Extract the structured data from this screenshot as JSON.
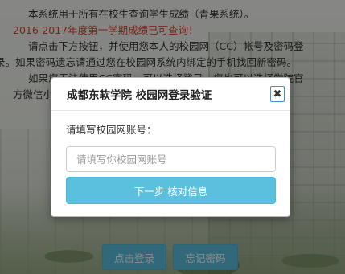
{
  "background": {
    "lines": [
      "本系统用于所有在校生查询学生成绩（青果系统）。",
      "2016-2017年度第一学期成绩已可查询！",
      "请点击下方按钮，并使用您本人的校园网（CC）帐号及密码登",
      "录。如果密码遗忘请通过您在校园网系统内绑定的手机找回新密码。",
      "如果您无法使用CC密码，可以选择登录。您也可以选择学院官",
      "方微信小程"
    ],
    "login_button": "点击登录",
    "forgot_button": "忘记密码"
  },
  "modal": {
    "title": "成都东软学院 校园网登录验证",
    "close_symbol": "✖",
    "field_label": "请填写校园网账号：",
    "input_placeholder": "请填写你校园网账号",
    "input_value": "",
    "submit_label": "下一步 核对信息"
  },
  "colors": {
    "accent": "#5bc0de",
    "alert_text": "#e23b2e"
  }
}
